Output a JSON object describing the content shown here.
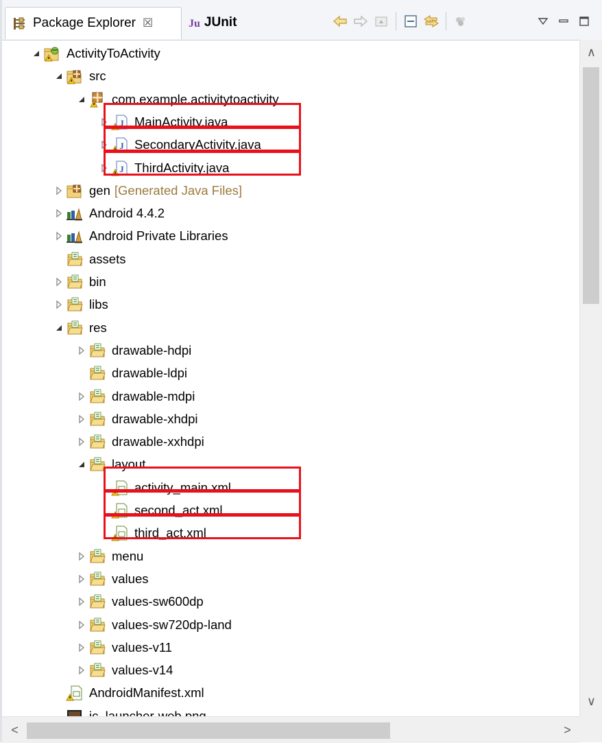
{
  "tabs": {
    "package_explorer": {
      "label": "Package Explorer",
      "close": "☒"
    },
    "junit": {
      "label": "JUnit",
      "logo": "Ju"
    }
  },
  "toolbar_icons": [
    "back-arrow-icon",
    "forward-arrow-icon",
    "up-folder-icon",
    "collapse-all-icon",
    "link-with-editor-icon",
    "filters-icon",
    "view-menu-icon",
    "minimize-icon",
    "maximize-icon"
  ],
  "tree": {
    "rows": [
      {
        "label": "ActivityToActivity",
        "icon": "android-project-icon",
        "arrow": "expanded"
      },
      {
        "label": "src",
        "icon": "source-folder-icon",
        "arrow": "expanded"
      },
      {
        "label": "com.example.activitytoactivity",
        "icon": "package-icon",
        "arrow": "expanded"
      },
      {
        "label": "MainActivity.java",
        "icon": "java-file-icon",
        "arrow": "collapsed"
      },
      {
        "label": "SecondaryActivity.java",
        "icon": "java-file-icon",
        "arrow": "collapsed"
      },
      {
        "label": "ThirdActivity.java",
        "icon": "java-file-icon",
        "arrow": "collapsed"
      },
      {
        "label": "gen",
        "decoration": "[Generated Java Files]",
        "icon": "gen-folder-icon",
        "arrow": "collapsed"
      },
      {
        "label": "Android 4.4.2",
        "icon": "library-icon",
        "arrow": "collapsed"
      },
      {
        "label": "Android Private Libraries",
        "icon": "library-icon",
        "arrow": "collapsed"
      },
      {
        "label": "assets",
        "icon": "folder-icon",
        "arrow": "none"
      },
      {
        "label": "bin",
        "icon": "folder-icon",
        "arrow": "collapsed"
      },
      {
        "label": "libs",
        "icon": "folder-icon",
        "arrow": "collapsed"
      },
      {
        "label": "res",
        "icon": "folder-icon",
        "arrow": "expanded"
      },
      {
        "label": "drawable-hdpi",
        "icon": "folder-icon",
        "arrow": "collapsed"
      },
      {
        "label": "drawable-ldpi",
        "icon": "folder-icon",
        "arrow": "none"
      },
      {
        "label": "drawable-mdpi",
        "icon": "folder-icon",
        "arrow": "collapsed"
      },
      {
        "label": "drawable-xhdpi",
        "icon": "folder-icon",
        "arrow": "collapsed"
      },
      {
        "label": "drawable-xxhdpi",
        "icon": "folder-icon",
        "arrow": "collapsed"
      },
      {
        "label": "layout",
        "icon": "folder-icon",
        "arrow": "expanded"
      },
      {
        "label": "activity_main.xml",
        "icon": "xml-file-icon",
        "arrow": "none"
      },
      {
        "label": "second_act.xml",
        "icon": "xml-file-icon",
        "arrow": "none"
      },
      {
        "label": "third_act.xml",
        "icon": "xml-file-icon",
        "arrow": "none"
      },
      {
        "label": "menu",
        "icon": "folder-icon",
        "arrow": "collapsed"
      },
      {
        "label": "values",
        "icon": "folder-icon",
        "arrow": "collapsed"
      },
      {
        "label": "values-sw600dp",
        "icon": "folder-icon",
        "arrow": "collapsed"
      },
      {
        "label": "values-sw720dp-land",
        "icon": "folder-icon",
        "arrow": "collapsed"
      },
      {
        "label": "values-v11",
        "icon": "folder-icon",
        "arrow": "collapsed"
      },
      {
        "label": "values-v14",
        "icon": "folder-icon",
        "arrow": "collapsed"
      },
      {
        "label": "AndroidManifest.xml",
        "icon": "xml-file-icon",
        "arrow": "none"
      },
      {
        "label": "ic_launcher-web.png",
        "icon": "png-image-icon",
        "arrow": "none"
      }
    ]
  },
  "scrollbar": {
    "up": "∧",
    "down": "∨",
    "left": "<",
    "right": ">"
  },
  "colors": {
    "highlight_box": "#e8111b",
    "decoration_text": "#9c7a3c"
  }
}
